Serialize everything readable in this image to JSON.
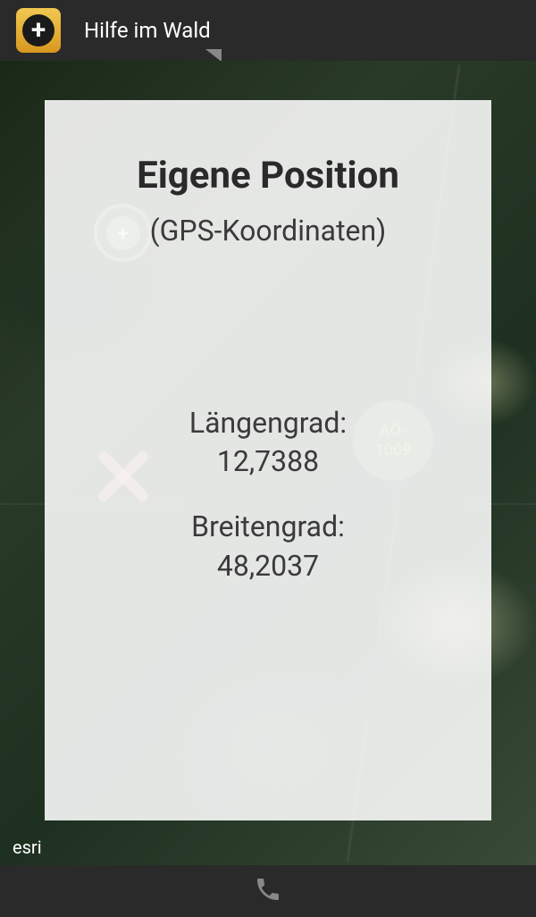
{
  "header": {
    "app_title": "Hilfe im Wald"
  },
  "map": {
    "attribution": "esri",
    "marker_label_line1": "AÖ-",
    "marker_label_line2": "1009"
  },
  "panel": {
    "title": "Eigene Position",
    "subtitle": "(GPS-Koordinaten)",
    "longitude_label": "Längengrad:",
    "longitude_value": "12,7388",
    "latitude_label": "Breitengrad:",
    "latitude_value": "48,2037"
  }
}
